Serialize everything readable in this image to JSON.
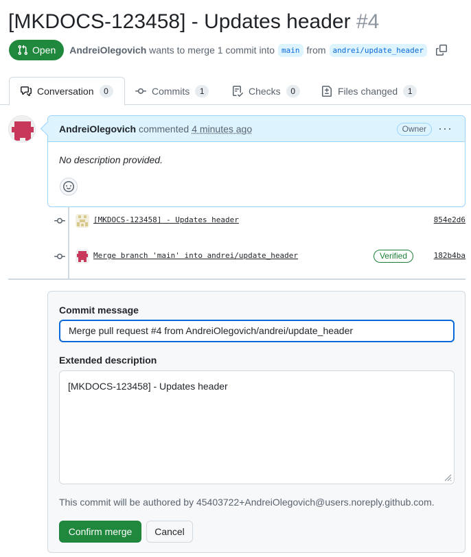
{
  "pr": {
    "title": "[MKDOCS-123458] - Updates header",
    "number": "#4",
    "state": "Open",
    "author": "AndreiOlegovich",
    "action_text": "wants to merge 1 commit into",
    "base_branch": "main",
    "from_text": "from",
    "head_branch": "andrei/update_header"
  },
  "tabs": [
    {
      "label": "Conversation",
      "count": "0",
      "icon": "comment-discussion-icon"
    },
    {
      "label": "Commits",
      "count": "1",
      "icon": "git-commit-icon"
    },
    {
      "label": "Checks",
      "count": "0",
      "icon": "checklist-icon"
    },
    {
      "label": "Files changed",
      "count": "1",
      "icon": "file-diff-icon"
    }
  ],
  "comment": {
    "author": "AndreiOlegovich",
    "action": "commented",
    "time": "4 minutes ago",
    "role": "Owner",
    "body": "No description provided."
  },
  "commits": [
    {
      "message": "[MKDOCS-123458] - Updates header",
      "sha": "854e2d6",
      "verified": ""
    },
    {
      "message": "Merge branch 'main' into andrei/update_header",
      "sha": "182b4ba",
      "verified": "Verified"
    }
  ],
  "merge_form": {
    "commit_message_label": "Commit message",
    "commit_message_value": "Merge pull request #4 from AndreiOlegovich/andrei/update_header",
    "extended_description_label": "Extended description",
    "extended_description_value": "[MKDOCS-123458] - Updates header",
    "author_note": "This commit will be authored by 45403722+AndreiOlegovich@users.noreply.github.com.",
    "confirm_label": "Confirm merge",
    "cancel_label": "Cancel"
  },
  "colors": {
    "open_green": "#1f883d",
    "link_blue": "#0969da",
    "header_blue": "#ddf4ff",
    "avatar_red": "#c8385a"
  }
}
